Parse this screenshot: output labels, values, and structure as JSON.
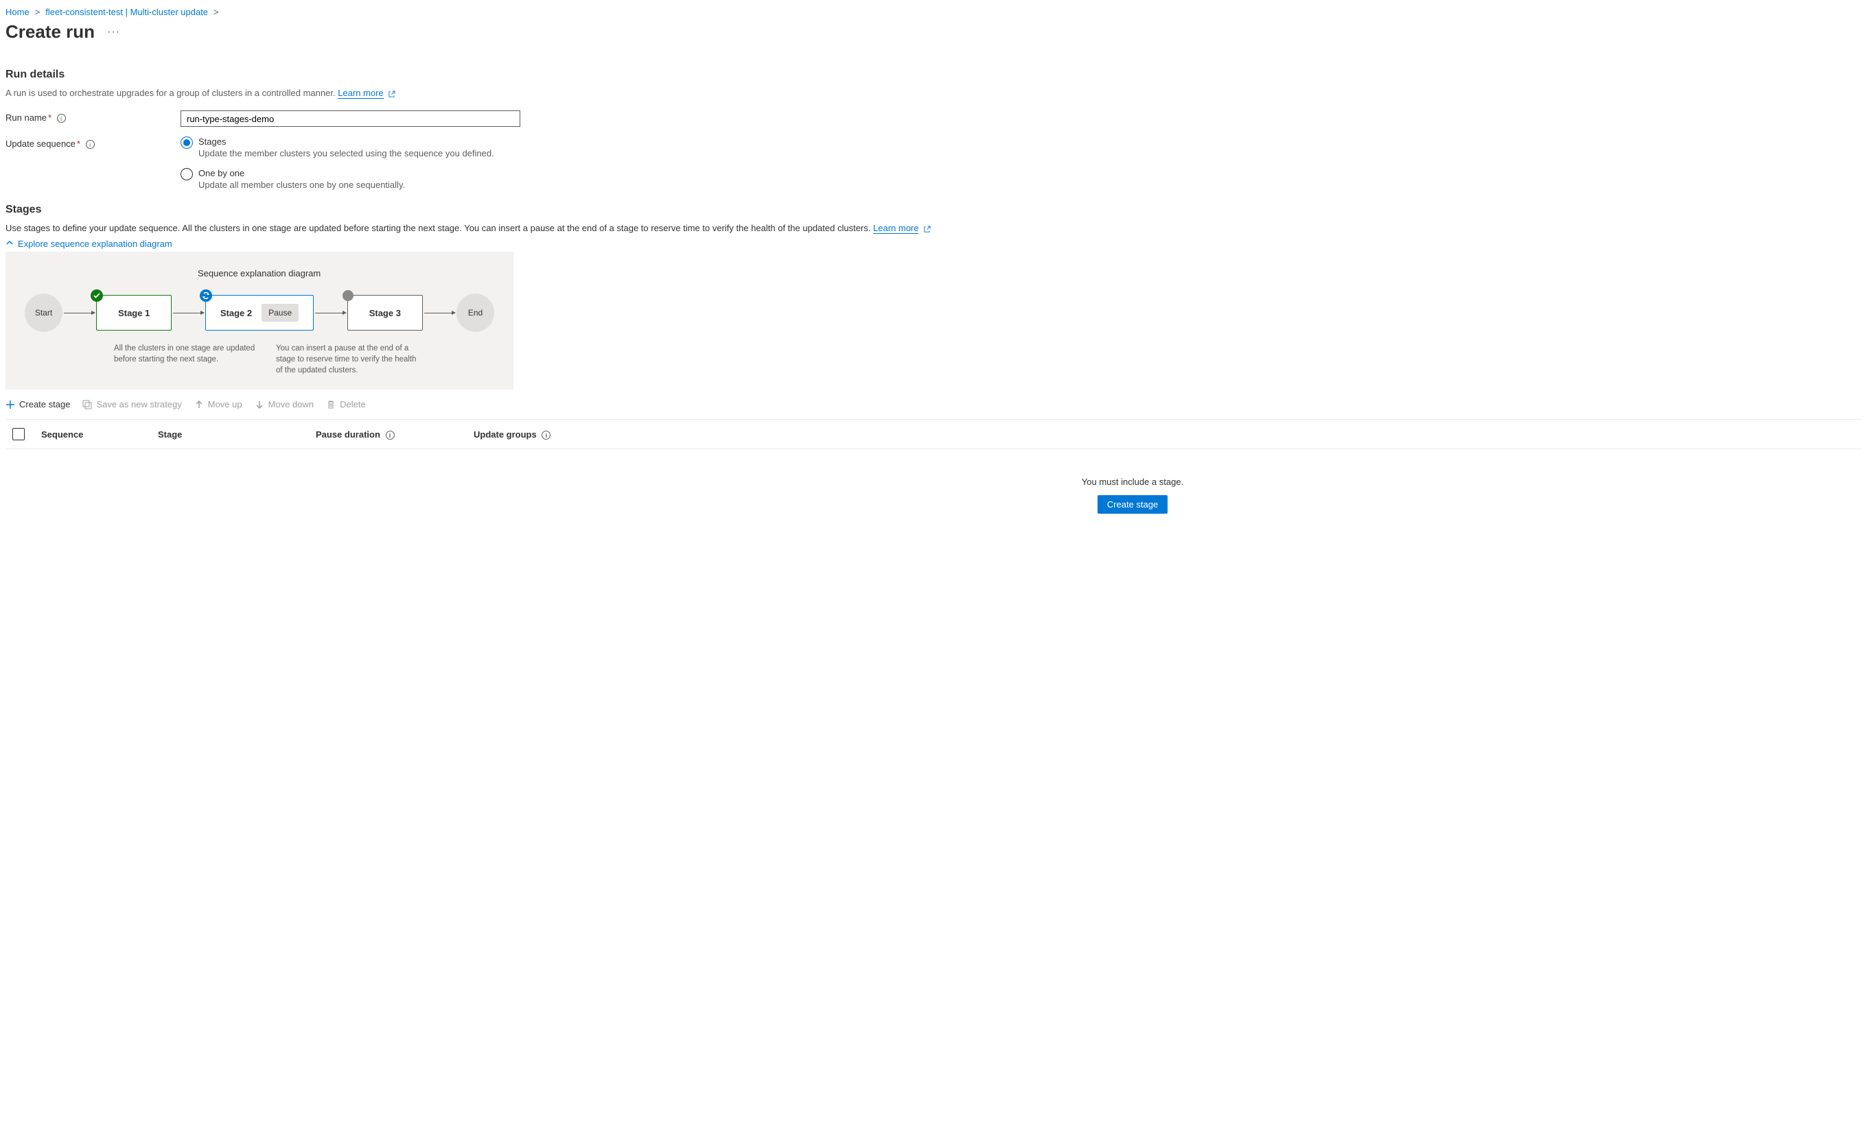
{
  "breadcrumb": {
    "home": "Home",
    "context": "fleet-consistent-test | Multi-cluster update"
  },
  "page_title": "Create run",
  "run_details": {
    "heading": "Run details",
    "description": "A run is used to orchestrate upgrades for a group of clusters in a controlled manner.",
    "learn_more": "Learn more",
    "run_name_label": "Run name",
    "run_name_value": "run-type-stages-demo",
    "update_sequence_label": "Update sequence",
    "options": {
      "stages": {
        "title": "Stages",
        "desc": "Update the member clusters you selected using the sequence you defined.",
        "selected": true
      },
      "one_by_one": {
        "title": "One by one",
        "desc": "Update all member clusters one by one sequentially.",
        "selected": false
      }
    }
  },
  "stages": {
    "heading": "Stages",
    "description": "Use stages to define your update sequence. All the clusters in one stage are updated before starting the next stage. You can insert a pause at the end of a stage to reserve time to verify the health of the updated clusters.",
    "learn_more": "Learn more",
    "explore_toggle": "Explore sequence explanation diagram",
    "diagram": {
      "title": "Sequence explanation diagram",
      "start": "Start",
      "stage1": "Stage 1",
      "stage2": "Stage 2",
      "pause": "Pause",
      "stage3": "Stage 3",
      "end": "End",
      "caption1": "All the clusters in one stage are updated before starting the next stage.",
      "caption2": "You can insert a pause at the end of a stage to reserve time to verify the health of the updated clusters."
    },
    "toolbar": {
      "create": "Create stage",
      "save": "Save as new strategy",
      "move_up": "Move up",
      "move_down": "Move down",
      "delete": "Delete"
    },
    "table": {
      "columns": {
        "sequence": "Sequence",
        "stage": "Stage",
        "pause_duration": "Pause duration",
        "update_groups": "Update groups"
      }
    },
    "empty": {
      "message": "You must include a stage.",
      "button": "Create stage"
    }
  }
}
